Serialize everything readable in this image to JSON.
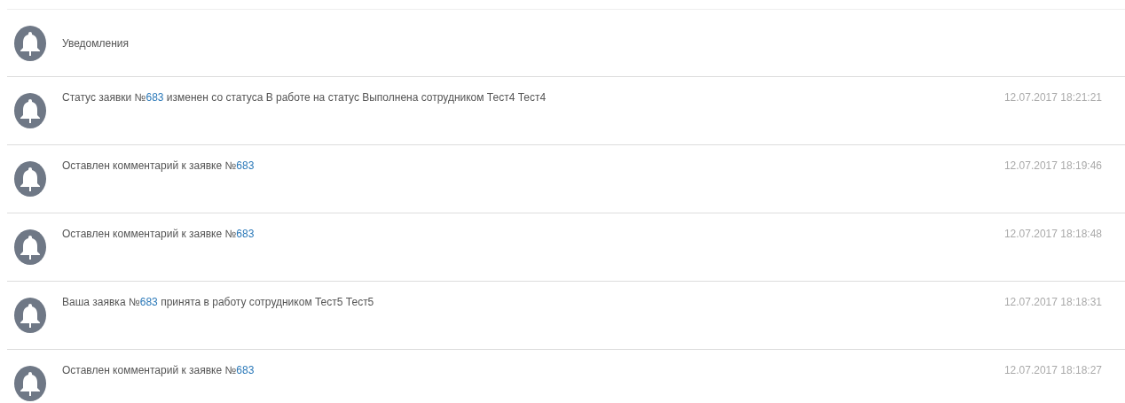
{
  "header": {
    "title": "Уведомления"
  },
  "notifications": [
    {
      "text_before": "Статус заявки №",
      "link": "683",
      "text_after": " изменен со статуса В работе на статус Выполнена сотрудником Тест4 Тест4",
      "time": "12.07.2017 18:21:21"
    },
    {
      "text_before": "Оставлен комментарий к заявке №",
      "link": "683",
      "time": "12.07.2017 18:19:46"
    },
    {
      "text_before": "Оставлен комментарий к заявке №",
      "link": "683",
      "time": "12.07.2017 18:18:48"
    },
    {
      "text_before": "Ваша заявка №",
      "link": "683",
      "text_after": " принята в работу сотрудником Тест5 Тест5",
      "time": "12.07.2017 18:18:31"
    },
    {
      "text_before": "Оставлен комментарий к заявке №",
      "link": "683",
      "time": "12.07.2017 18:18:27"
    }
  ]
}
